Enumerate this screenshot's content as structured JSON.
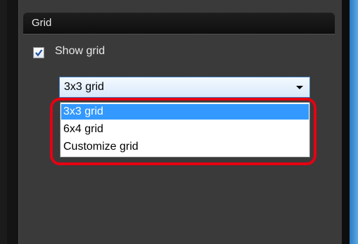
{
  "panel": {
    "title": "Grid"
  },
  "show_grid": {
    "label": "Show grid",
    "checked": true
  },
  "grid_select": {
    "value": "3x3 grid",
    "options": [
      "3x3 grid",
      "6x4 grid",
      "Customize grid"
    ],
    "selected_index": 0
  },
  "icons": {
    "check": "checkmark-icon",
    "dropdown": "chevron-down-icon"
  },
  "colors": {
    "panel_bg": "#3a3a3a",
    "header_bg": "#0e0e0e",
    "selection": "#3399ff",
    "highlight_ring": "#e60012",
    "accent_blue": "#2b7cc2"
  }
}
